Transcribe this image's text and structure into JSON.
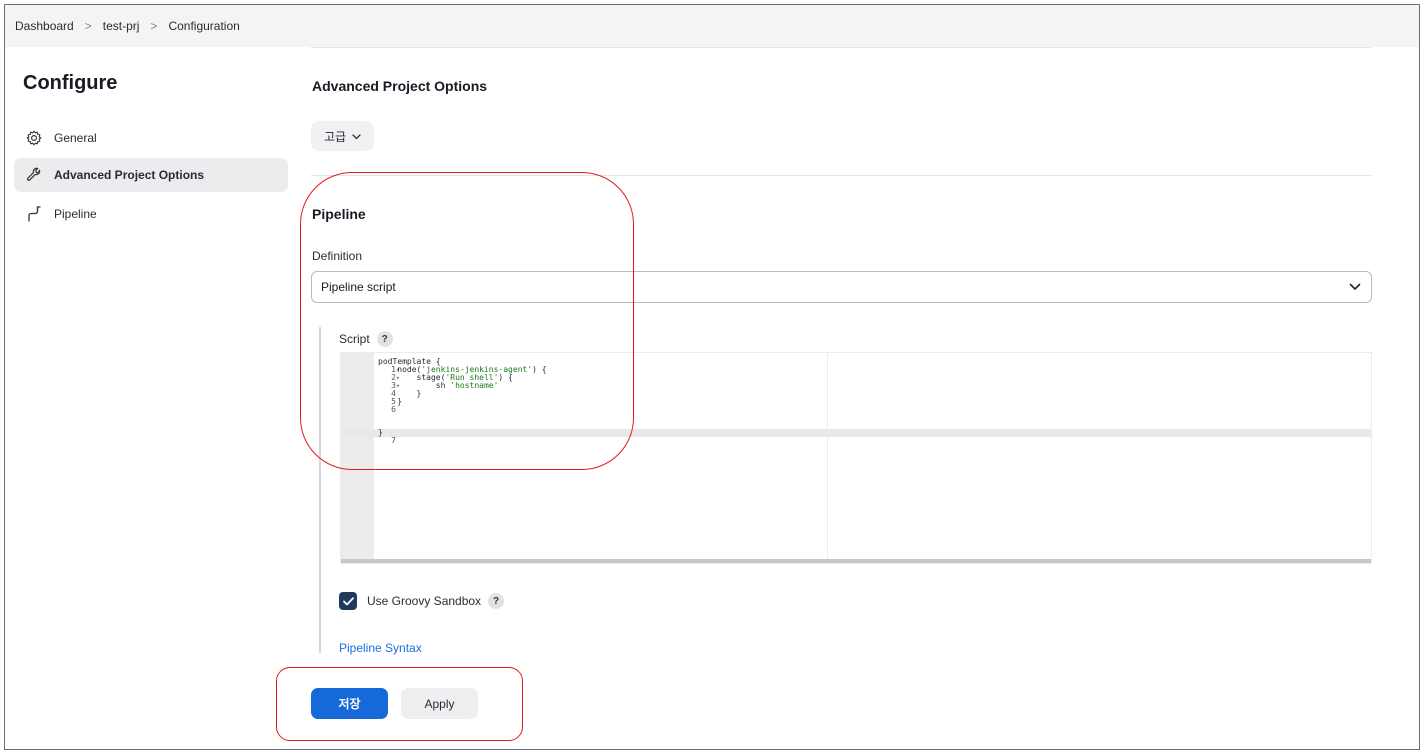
{
  "breadcrumb": {
    "items": [
      "Dashboard",
      "test-prj",
      "Configuration"
    ],
    "separator": ">"
  },
  "sidebar": {
    "title": "Configure",
    "items": [
      {
        "label": "General",
        "icon": "gear-icon",
        "active": false
      },
      {
        "label": "Advanced Project Options",
        "icon": "wrench-icon",
        "active": true
      },
      {
        "label": "Pipeline",
        "icon": "pipeline-icon",
        "active": false
      }
    ]
  },
  "main": {
    "advanced_title": "Advanced Project Options",
    "advanced_button": "고급",
    "pipeline_title": "Pipeline",
    "definition_label": "Definition",
    "definition_value": "Pipeline script",
    "script_label": "Script",
    "help_glyph": "?",
    "script_lines": [
      {
        "n": "1",
        "fold": true,
        "text": "podTemplate {"
      },
      {
        "n": "2",
        "fold": true,
        "text": "    node('jenkins-jenkins-agent') {"
      },
      {
        "n": "3",
        "fold": true,
        "text": "        stage('Run shell') {"
      },
      {
        "n": "4",
        "fold": false,
        "text": "            sh 'hostname'"
      },
      {
        "n": "5",
        "fold": false,
        "text": "        }"
      },
      {
        "n": "6",
        "fold": false,
        "text": "    }"
      },
      {
        "n": "7",
        "fold": false,
        "text": "}"
      }
    ],
    "sandbox_label": "Use Groovy Sandbox",
    "sandbox_checked": true,
    "syntax_link": "Pipeline Syntax",
    "save_button": "저장",
    "apply_button": "Apply"
  },
  "colors": {
    "primary": "#1569d8",
    "annotation": "#e01b1b",
    "checkbox": "#1f3a5f",
    "link": "#1c6fdc"
  }
}
